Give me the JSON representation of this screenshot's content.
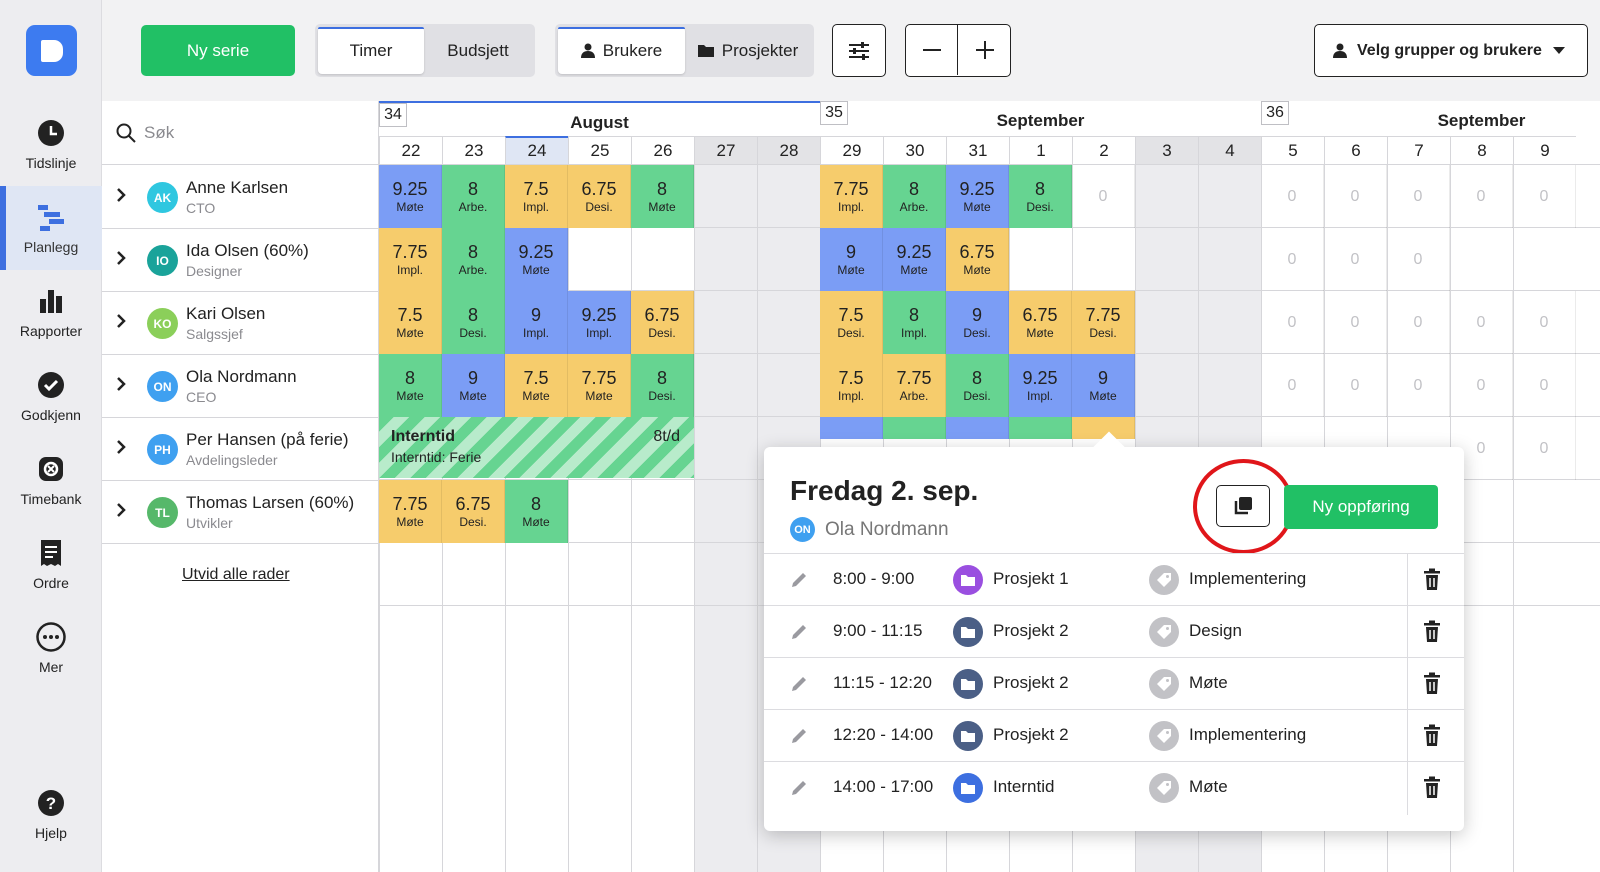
{
  "sidebar": {
    "items": [
      {
        "label": "Tidslinje",
        "icon": "clock-icon"
      },
      {
        "label": "Planlegg",
        "icon": "planner-icon",
        "active": true
      },
      {
        "label": "Rapporter",
        "icon": "bar-chart-icon"
      },
      {
        "label": "Godkjenn",
        "icon": "check-circle-icon"
      },
      {
        "label": "Timebank",
        "icon": "timebank-icon"
      },
      {
        "label": "Ordre",
        "icon": "document-icon"
      },
      {
        "label": "Mer",
        "icon": "more-icon"
      },
      {
        "label": "Hjelp",
        "icon": "help-icon"
      }
    ]
  },
  "toolbar": {
    "new_series": "Ny serie",
    "mode_tabs": [
      "Timer",
      "Budsjett"
    ],
    "view_tabs": [
      "Brukere",
      "Prosjekter"
    ],
    "select_label": "Velg grupper og brukere"
  },
  "search": {
    "placeholder": "Søk"
  },
  "people": [
    {
      "initials": "AK",
      "name": "Anne Karlsen",
      "role": "CTO",
      "color": "#2fc7e0"
    },
    {
      "initials": "IO",
      "name": "Ida Olsen (60%)",
      "role": "Designer",
      "color": "#1aa39a"
    },
    {
      "initials": "KO",
      "name": "Kari Olsen",
      "role": "Salgssjef",
      "color": "#8bcf5a"
    },
    {
      "initials": "ON",
      "name": "Ola Nordmann",
      "role": "CEO",
      "color": "#3fa0f0"
    },
    {
      "initials": "PH",
      "name": "Per Hansen (på ferie)",
      "role": "Avdelingsleder",
      "color": "#3fa0f0"
    },
    {
      "initials": "TL",
      "name": "Thomas Larsen (60%)",
      "role": "Utvikler",
      "color": "#56b86a"
    }
  ],
  "expand_all": "Utvid alle rader",
  "weeks": [
    {
      "num": "34",
      "month": "August"
    },
    {
      "num": "35",
      "month": "September"
    },
    {
      "num": "36",
      "month": "September"
    }
  ],
  "days": [
    "22",
    "23",
    "24",
    "25",
    "26",
    "27",
    "28",
    "29",
    "30",
    "31",
    "1",
    "2",
    "3",
    "4",
    "5",
    "6",
    "7",
    "8",
    "9"
  ],
  "weekend_indices": [
    5,
    6,
    12,
    13
  ],
  "today_index": 2,
  "grid": [
    [
      [
        "9.25",
        "Møte",
        "b"
      ],
      [
        "8",
        "Arbe.",
        "g"
      ],
      [
        "7.5",
        "Impl.",
        "y"
      ],
      [
        "6.75",
        "Desi.",
        "y"
      ],
      [
        "8",
        "Møte",
        "g"
      ],
      null,
      null,
      [
        "7.75",
        "Impl.",
        "y"
      ],
      [
        "8",
        "Arbe.",
        "g"
      ],
      [
        "9.25",
        "Møte",
        "b"
      ],
      [
        "8",
        "Desi.",
        "g"
      ],
      [
        "0",
        "",
        "z"
      ],
      null,
      null,
      [
        "0",
        "",
        "z"
      ],
      [
        "0",
        "",
        "z"
      ],
      [
        "0",
        "",
        "z"
      ],
      [
        "0",
        "",
        "z"
      ],
      [
        "0",
        "",
        "z"
      ]
    ],
    [
      [
        "7.75",
        "Impl.",
        "y"
      ],
      [
        "8",
        "Arbe.",
        "g"
      ],
      [
        "9.25",
        "Møte",
        "b"
      ],
      null,
      null,
      null,
      null,
      [
        "9",
        "Møte",
        "b"
      ],
      [
        "9.25",
        "Møte",
        "b"
      ],
      [
        "6.75",
        "Møte",
        "y"
      ],
      null,
      null,
      null,
      null,
      [
        "0",
        "",
        "z"
      ],
      [
        "0",
        "",
        "z"
      ],
      [
        "0",
        "",
        "z"
      ],
      null,
      null
    ],
    [
      [
        "7.5",
        "Møte",
        "y"
      ],
      [
        "8",
        "Desi.",
        "g"
      ],
      [
        "9",
        "Impl.",
        "b"
      ],
      [
        "9.25",
        "Impl.",
        "b"
      ],
      [
        "6.75",
        "Desi.",
        "y"
      ],
      null,
      null,
      [
        "7.5",
        "Desi.",
        "y"
      ],
      [
        "8",
        "Impl.",
        "g"
      ],
      [
        "9",
        "Desi.",
        "b"
      ],
      [
        "6.75",
        "Møte",
        "y"
      ],
      [
        "7.75",
        "Desi.",
        "y"
      ],
      null,
      null,
      [
        "0",
        "",
        "z"
      ],
      [
        "0",
        "",
        "z"
      ],
      [
        "0",
        "",
        "z"
      ],
      [
        "0",
        "",
        "z"
      ],
      [
        "0",
        "",
        "z"
      ]
    ],
    [
      [
        "8",
        "Møte",
        "g"
      ],
      [
        "9",
        "Møte",
        "b"
      ],
      [
        "7.5",
        "Møte",
        "y"
      ],
      [
        "7.75",
        "Møte",
        "y"
      ],
      [
        "8",
        "Desi.",
        "g"
      ],
      null,
      null,
      [
        "7.5",
        "Impl.",
        "y"
      ],
      [
        "7.75",
        "Arbe.",
        "y"
      ],
      [
        "8",
        "Desi.",
        "g"
      ],
      [
        "9.25",
        "Impl.",
        "b"
      ],
      [
        "9",
        "Møte",
        "b"
      ],
      null,
      null,
      [
        "0",
        "",
        "z"
      ],
      [
        "0",
        "",
        "z"
      ],
      [
        "0",
        "",
        "z"
      ],
      [
        "0",
        "",
        "z"
      ],
      [
        "0",
        "",
        "z"
      ]
    ],
    [
      null,
      null,
      null,
      null,
      null,
      null,
      null,
      [
        "",
        "",
        "b"
      ],
      [
        "",
        "",
        "g"
      ],
      [
        "",
        "",
        "b"
      ],
      [
        "",
        "",
        "g"
      ],
      [
        "",
        "",
        "y"
      ],
      null,
      null,
      null,
      null,
      null,
      [
        "0",
        "",
        "z"
      ],
      [
        "0",
        "",
        "z"
      ]
    ],
    [
      [
        "7.75",
        "Møte",
        "y"
      ],
      [
        "6.75",
        "Desi.",
        "y"
      ],
      [
        "8",
        "Møte",
        "g"
      ],
      null,
      null,
      null,
      null,
      null,
      null,
      null,
      null,
      null,
      null,
      null,
      null,
      null,
      null,
      null,
      null
    ]
  ],
  "ferie": {
    "title": "Interntid",
    "subtitle": "Interntid: Ferie",
    "rate": "8t/d"
  },
  "popup": {
    "title": "Fredag 2. sep.",
    "user_initials": "ON",
    "user_name": "Ola Nordmann",
    "new_entry": "Ny oppføring",
    "entries": [
      {
        "time": "8:00 - 9:00",
        "project": "Prosjekt 1",
        "project_color": "#9a4fe0",
        "tag": "Implementering"
      },
      {
        "time": "9:00 - 11:15",
        "project": "Prosjekt 2",
        "project_color": "#4b5f86",
        "tag": "Design"
      },
      {
        "time": "11:15 - 12:20",
        "project": "Prosjekt 2",
        "project_color": "#4b5f86",
        "tag": "Møte"
      },
      {
        "time": "12:20 - 14:00",
        "project": "Prosjekt 2",
        "project_color": "#4b5f86",
        "tag": "Implementering"
      },
      {
        "time": "14:00 - 17:00",
        "project": "Interntid",
        "project_color": "#3d6fe0",
        "tag": "Møte"
      }
    ]
  },
  "colors": {
    "green": "#21c065",
    "blue": "#7b9df5",
    "teal": "#66d491",
    "yellow": "#f6cc6c",
    "accent": "#3d6fe0",
    "highlight_ring": "#e0161a"
  }
}
